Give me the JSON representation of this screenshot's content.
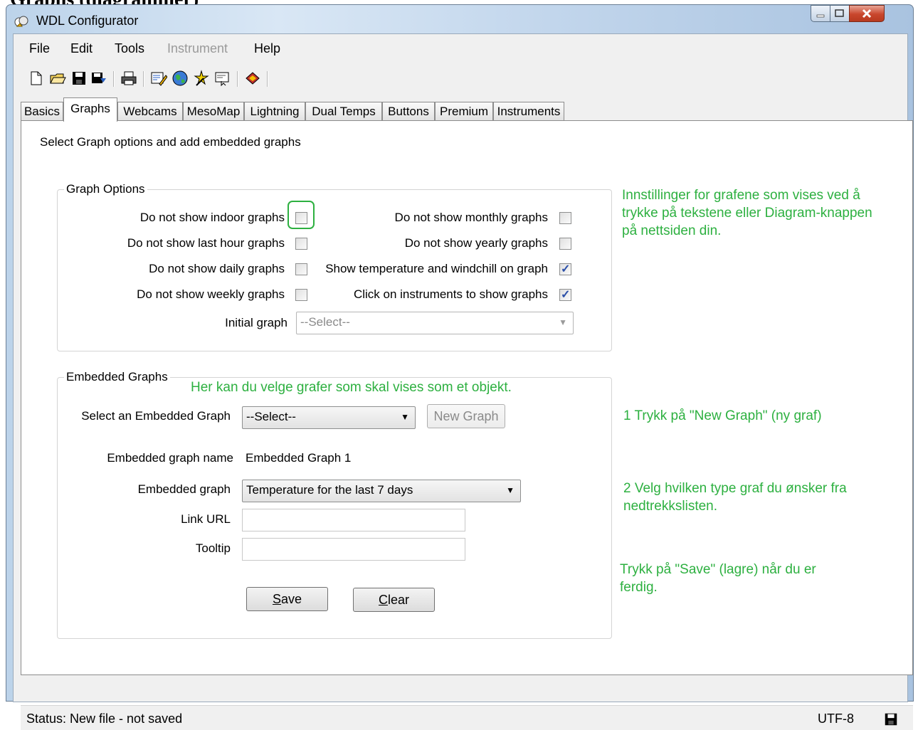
{
  "page_heading": "Graphs (diagrammer)",
  "window": {
    "title": "WDL Configurator"
  },
  "menu": [
    "File",
    "Edit",
    "Tools",
    "Instrument",
    "Help"
  ],
  "toolbar_icons": [
    "new-file-icon",
    "open-folder-icon",
    "save-icon",
    "save-as-icon",
    "print-icon",
    "edit-icon",
    "globe-icon",
    "wizard-icon",
    "preview-icon",
    "help-book-icon"
  ],
  "tabs": [
    "Basics",
    "Graphs",
    "Webcams",
    "MesoMap",
    "Lightning",
    "Dual Temps",
    "Buttons",
    "Premium",
    "Instruments"
  ],
  "active_tab": "Graphs",
  "intro": "Select Graph options and add embedded graphs",
  "graph_options": {
    "title": "Graph Options",
    "left": [
      {
        "label": "Do not show indoor graphs",
        "checked": false
      },
      {
        "label": "Do not show last hour graphs",
        "checked": false
      },
      {
        "label": "Do not show daily graphs",
        "checked": false
      },
      {
        "label": "Do not show weekly graphs",
        "checked": false
      }
    ],
    "right": [
      {
        "label": "Do not show monthly graphs",
        "checked": false
      },
      {
        "label": "Do not show yearly graphs",
        "checked": false
      },
      {
        "label": "Show temperature and windchill on graph",
        "checked": true
      },
      {
        "label": "Click on instruments to show graphs",
        "checked": true
      }
    ],
    "initial_graph_label": "Initial graph",
    "initial_graph_value": "--Select--"
  },
  "embedded": {
    "title": "Embedded Graphs",
    "select_label": "Select an Embedded Graph",
    "select_value": "--Select--",
    "new_graph_button": "New Graph",
    "name_label": "Embedded graph name",
    "name_value": "Embedded Graph 1",
    "graph_label": "Embedded graph",
    "graph_value": "Temperature for the last 7 days",
    "link_label": "Link URL",
    "link_value": "",
    "tooltip_label": "Tooltip",
    "tooltip_value": "",
    "save_button": "Save",
    "clear_button": "Clear"
  },
  "annotations": {
    "note1": "Innstillinger for grafene som vises ved å trykke på tekstene eller Diagram-knappen på nettsiden din.",
    "note2": "Her kan du velge grafer som skal vises som et objekt.",
    "note3": "1 Trykk på \"New Graph\" (ny graf)",
    "note4": "2 Velg hvilken type graf du ønsker fra nedtrekkslisten.",
    "note5": "Trykk på \"Save\" (lagre) når du er ferdig.",
    "highlight_color": "#2db040"
  },
  "status": {
    "text": "Status: New file - not saved",
    "encoding": "UTF-8"
  }
}
